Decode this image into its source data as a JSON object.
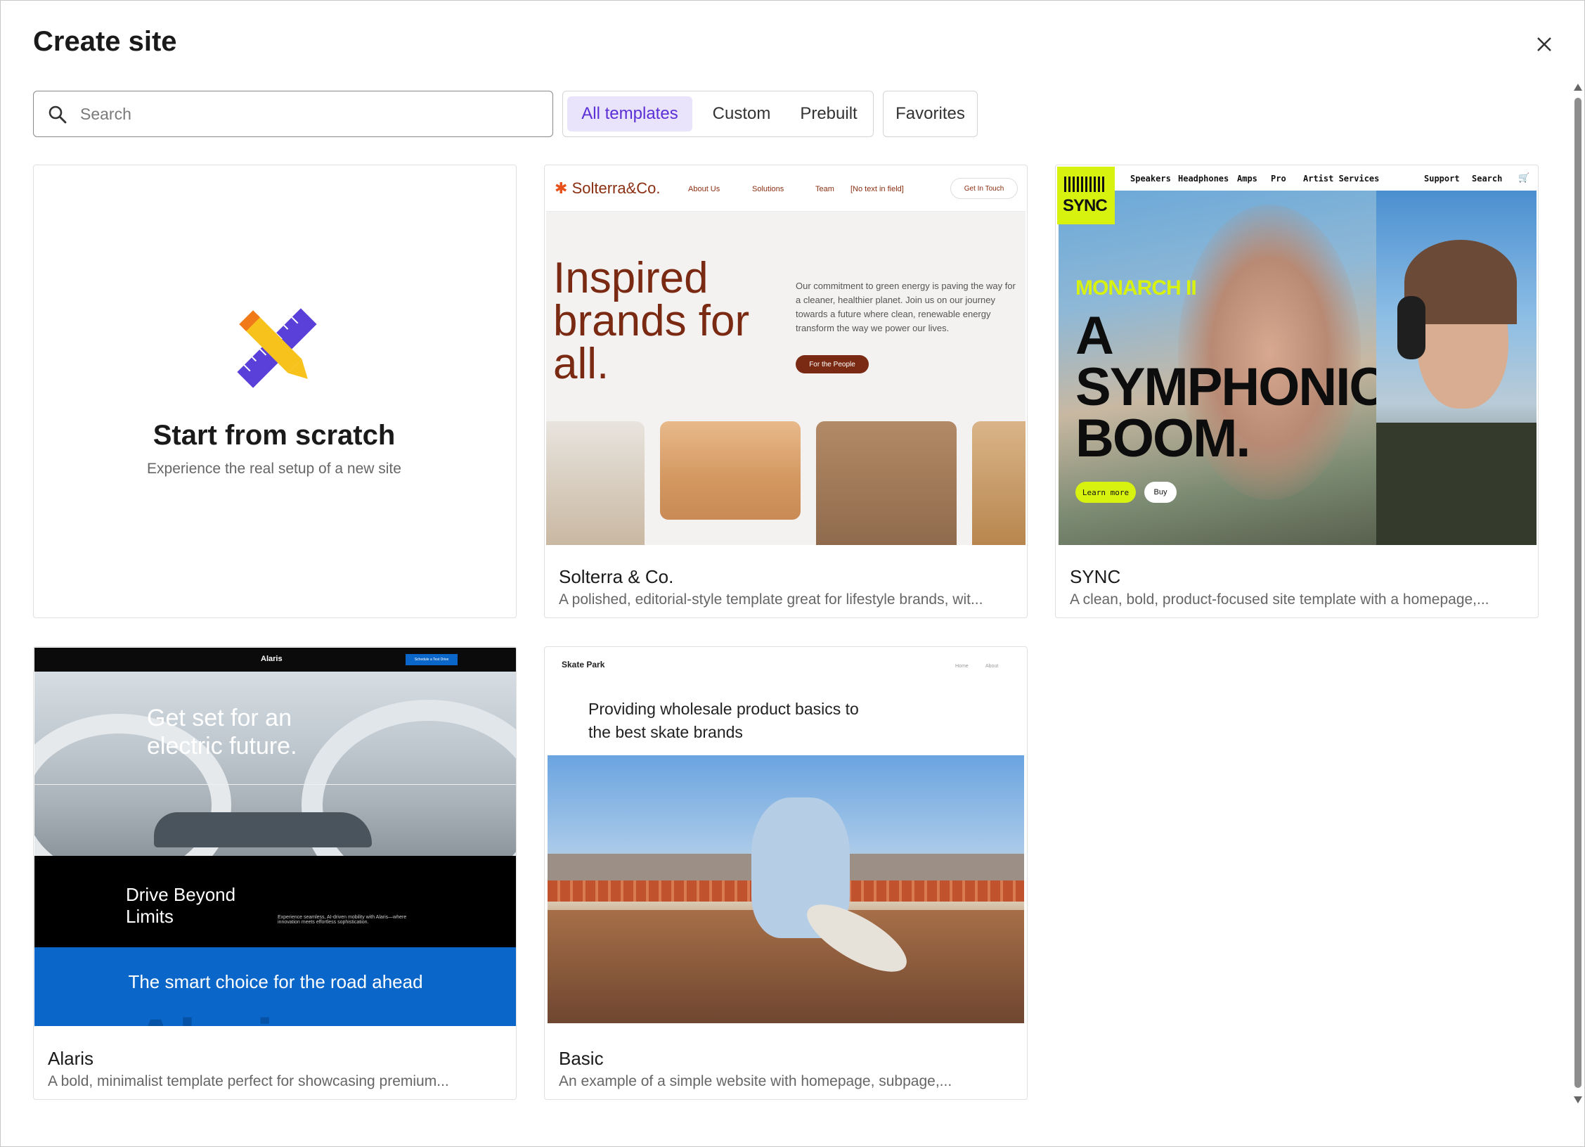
{
  "dialog": {
    "title": "Create site",
    "close_label": "×"
  },
  "search": {
    "placeholder": "Search",
    "value": ""
  },
  "filters": {
    "tabs": [
      {
        "label": "All templates",
        "active": true
      },
      {
        "label": "Custom",
        "active": false
      },
      {
        "label": "Prebuilt",
        "active": false
      }
    ],
    "favorites_label": "Favorites"
  },
  "scratch": {
    "title": "Start from scratch",
    "subtitle": "Experience the real setup of a new site"
  },
  "templates": [
    {
      "name": "Solterra & Co.",
      "description": "A polished, editorial-style template great for lifestyle brands, wit...",
      "preview": {
        "logo": "Solterra&Co.",
        "nav": [
          "About Us",
          "Solutions",
          "Team",
          "[No text in field]"
        ],
        "cta": "Get In Touch",
        "headline": "Inspired brands for all.",
        "paragraph": "Our commitment to green energy is paving the way for a cleaner, healthier planet. Join us on our journey towards a future where clean, renewable energy transform the way we power our lives.",
        "button": "For the People"
      }
    },
    {
      "name": "SYNC",
      "description": "A clean, bold, product-focused site template with a homepage,...",
      "preview": {
        "logo": "SYNC",
        "nav": [
          "Speakers",
          "Headphones",
          "Amps",
          "Pro",
          "Artist Services"
        ],
        "nav_right": [
          "Support",
          "Search"
        ],
        "tagline": "MONARCH II",
        "headline": "A SYMPHONIC BOOM.",
        "button_primary": "Learn more",
        "button_secondary": "Buy"
      }
    },
    {
      "name": "Alaris",
      "description": "A bold, minimalist template perfect for showcasing premium...",
      "preview": {
        "logo": "Alaris",
        "nav_cta": "Schedule a Test Drive",
        "hero_title": "Get set for an electric future.",
        "section_title": "Drive Beyond Limits",
        "section_text": "Experience seamless, AI-driven mobility with Alaris—where innovation meets effortless sophistication.",
        "blue_title": "The smart choice for the road ahead",
        "watermark": "Alaris"
      }
    },
    {
      "name": "Basic",
      "description": "An example of a simple website with homepage, subpage,...",
      "preview": {
        "brand": "Skate Park",
        "nav": [
          "Home",
          "About"
        ],
        "headline": "Providing wholesale product basics to the best skate brands"
      }
    }
  ],
  "colors": {
    "accent": "#5b2fd6",
    "accent_bg": "#e9e4fb",
    "sync_lime": "#d8f20f",
    "alaris_blue": "#0a66c9",
    "solterra_brown": "#7a2a12"
  }
}
